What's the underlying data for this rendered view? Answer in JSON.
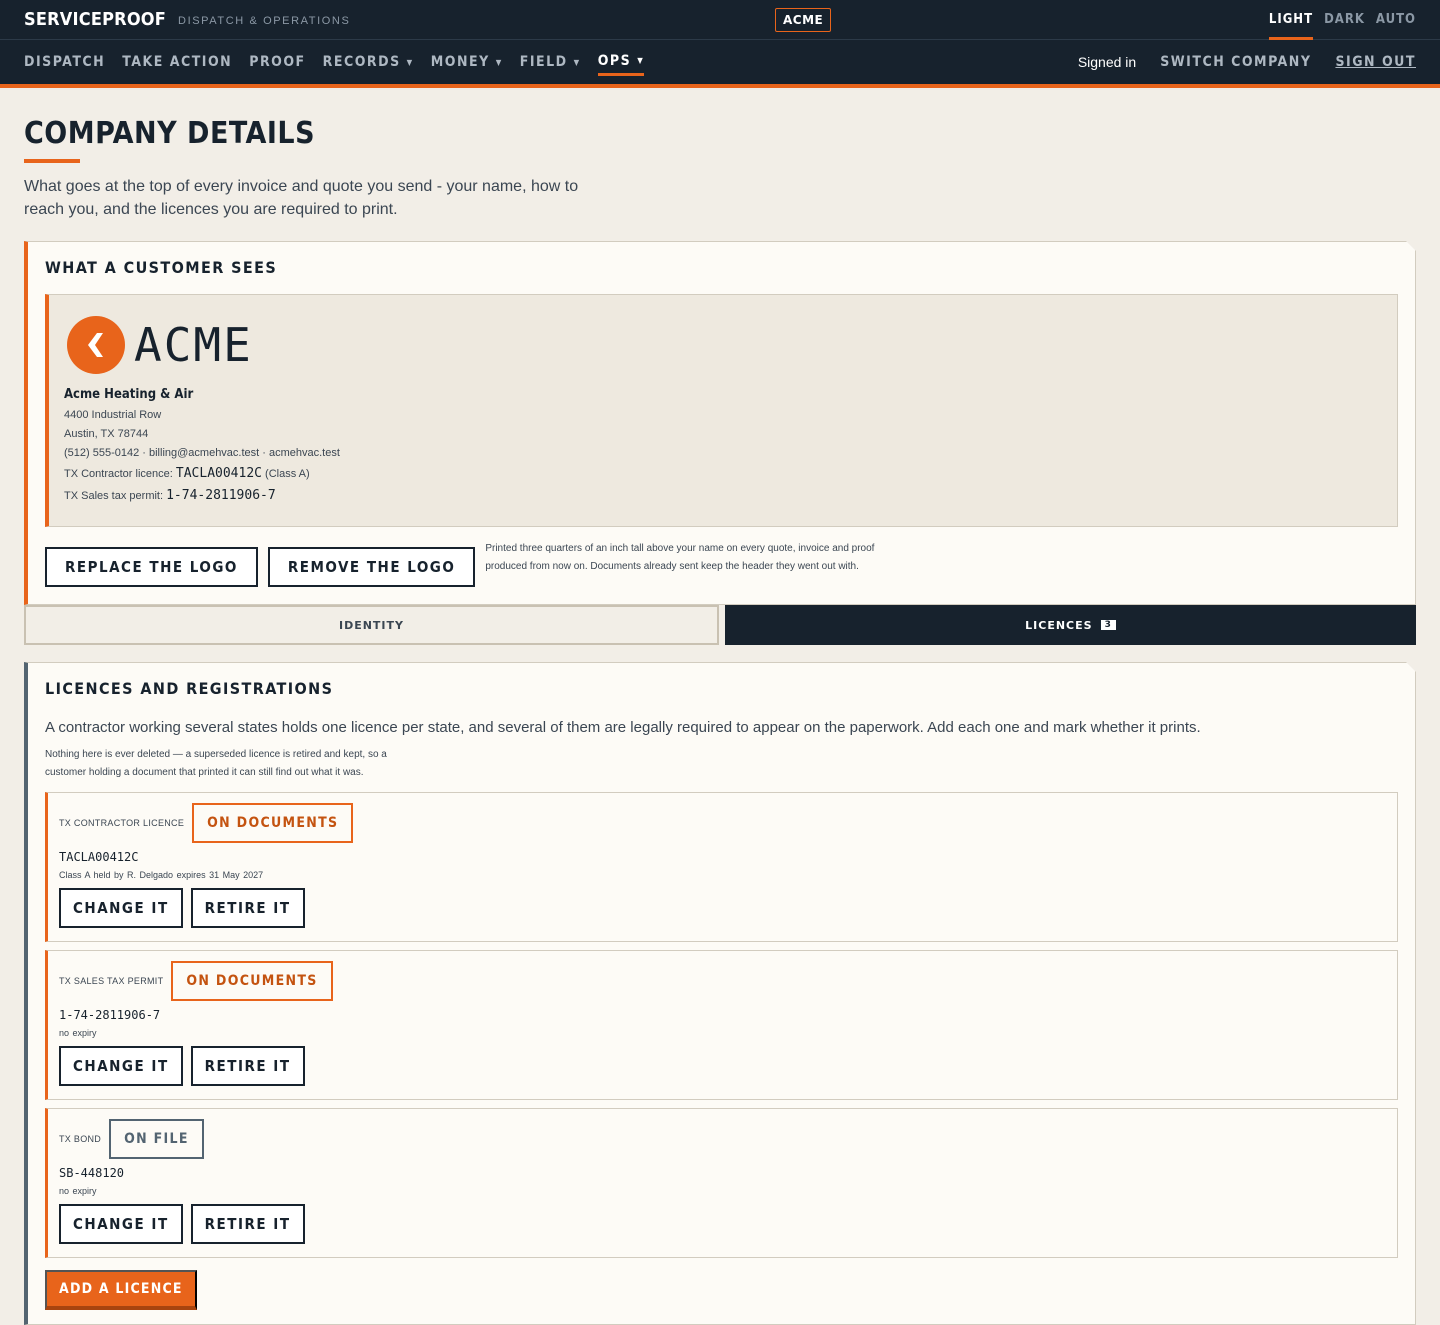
{
  "topbar": {
    "brand": "SERVICEPROOF",
    "subtitle": "DISPATCH & OPERATIONS",
    "company_chip": "ACME",
    "theme": [
      "LIGHT",
      "DARK",
      "AUTO"
    ]
  },
  "nav": {
    "items": [
      {
        "label": "DISPATCH"
      },
      {
        "label": "TAKE ACTION"
      },
      {
        "label": "PROOF"
      },
      {
        "label": "RECORDS",
        "caret": "▼"
      },
      {
        "label": "MONEY",
        "caret": "▼"
      },
      {
        "label": "FIELD",
        "caret": "▼"
      },
      {
        "label": "OPS",
        "caret": "▼",
        "active": true
      }
    ],
    "signed_in": "Signed in",
    "switch_company": "SWITCH COMPANY",
    "sign_out": "SIGN OUT"
  },
  "page": {
    "title": "COMPANY DETAILS",
    "lede": "What goes at the top of every invoice and quote you send - your name, how to reach you, and the licences you are required to print."
  },
  "customer_view": {
    "heading": "WHAT A CUSTOMER SEES",
    "logo_word": "ACME",
    "company_name": "Acme Heating & Air",
    "address_1": "4400 Industrial Row",
    "address_2": "Austin, TX 78744",
    "contact": "(512) 555-0142 · billing@acmehvac.test · acmehvac.test",
    "licence_label": "TX Contractor licence:",
    "licence_value": "TACLA00412C",
    "licence_class": "(Class A)",
    "permit_label": "TX Sales tax permit:",
    "permit_value": "1-74-2811906-7",
    "replace_logo": "REPLACE THE LOGO",
    "remove_logo": "REMOVE THE LOGO",
    "logo_hint": "Printed three quarters of an inch tall above your name on every quote, invoice and proof produced from now on. Documents already sent keep the header they went out with."
  },
  "tabs": {
    "identity": "IDENTITY",
    "licences": "LICENCES",
    "licences_count": "3"
  },
  "licences": {
    "heading": "LICENCES AND REGISTRATIONS",
    "intro": "A contractor working several states holds one licence per state, and several of them are legally required to appear on the paperwork. Add each one and mark whether it prints.",
    "note": "Nothing here is ever deleted — a superseded licence is retired and kept, so a customer holding a document that printed it can still find out what it was.",
    "items": [
      {
        "label": "TX CONTRACTOR LICENCE",
        "badge": "ON DOCUMENTS",
        "number": "TACLA00412C",
        "meta": "Class A   held by R. Delgado   expires 31 May 2027",
        "change": "CHANGE IT",
        "retire": "RETIRE IT"
      },
      {
        "label": "TX SALES TAX PERMIT",
        "badge": "ON DOCUMENTS",
        "number": "1-74-2811906-7",
        "meta": "no expiry",
        "change": "CHANGE IT",
        "retire": "RETIRE IT"
      },
      {
        "label": "TX BOND",
        "badge": "ON FILE",
        "number": "SB-448120",
        "meta": "no expiry",
        "change": "CHANGE IT",
        "retire": "RETIRE IT"
      }
    ],
    "add_button": "ADD A LICENCE"
  },
  "colors": {
    "accent": "#e8641b",
    "ink": "#17222d",
    "paper": "#f2eee7",
    "slate": "#536471"
  }
}
